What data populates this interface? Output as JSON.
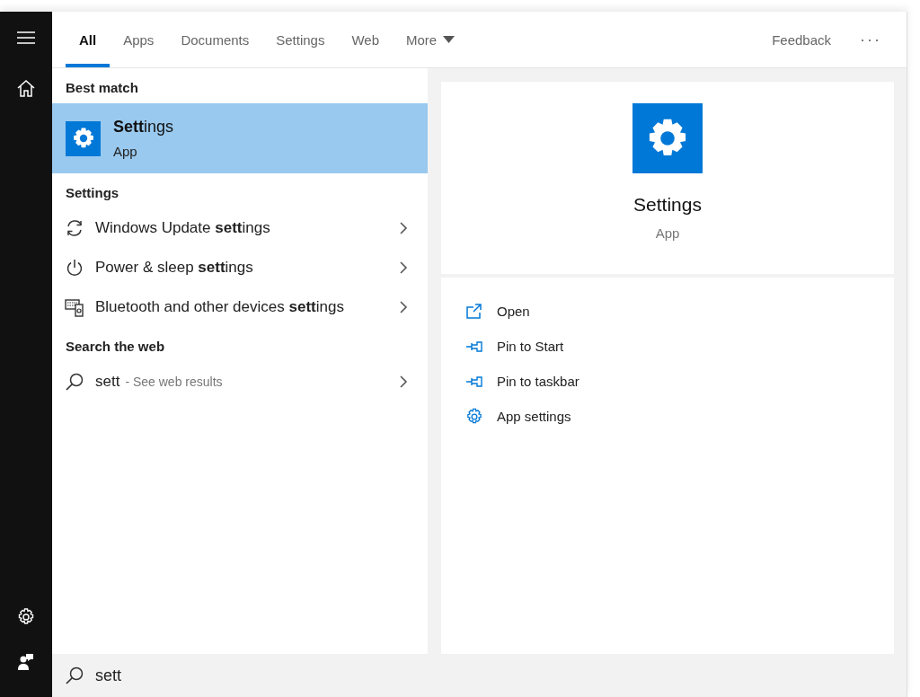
{
  "tabs": [
    {
      "label": "All",
      "selected": true,
      "dropdown": false
    },
    {
      "label": "Apps",
      "selected": false,
      "dropdown": false
    },
    {
      "label": "Documents",
      "selected": false,
      "dropdown": false
    },
    {
      "label": "Settings",
      "selected": false,
      "dropdown": false
    },
    {
      "label": "Web",
      "selected": false,
      "dropdown": false
    },
    {
      "label": "More",
      "selected": false,
      "dropdown": true
    }
  ],
  "feedback": "Feedback",
  "more_options": "···",
  "results": {
    "best_match_heading": "Best match",
    "best_match": {
      "title": "**Sett**ings",
      "subtitle": "App",
      "selected": true
    },
    "settings_heading": "Settings",
    "settings": [
      {
        "kind": "update",
        "label": "Windows Update **sett**ings"
      },
      {
        "kind": "power",
        "label": "Power & sleep **sett**ings"
      },
      {
        "kind": "devices",
        "label": "Bluetooth and other devices **sett**ings"
      }
    ],
    "web_heading": "Search the web",
    "web": {
      "query": "sett",
      "hint": "- See web results"
    }
  },
  "preview": {
    "title": "Settings",
    "subtitle": "App",
    "actions": [
      {
        "kind": "open",
        "label": "Open"
      },
      {
        "kind": "pin",
        "label": "Pin to Start"
      },
      {
        "kind": "pin",
        "label": "Pin to taskbar"
      },
      {
        "kind": "gear",
        "label": "App settings"
      }
    ]
  },
  "search": {
    "value": "sett"
  }
}
